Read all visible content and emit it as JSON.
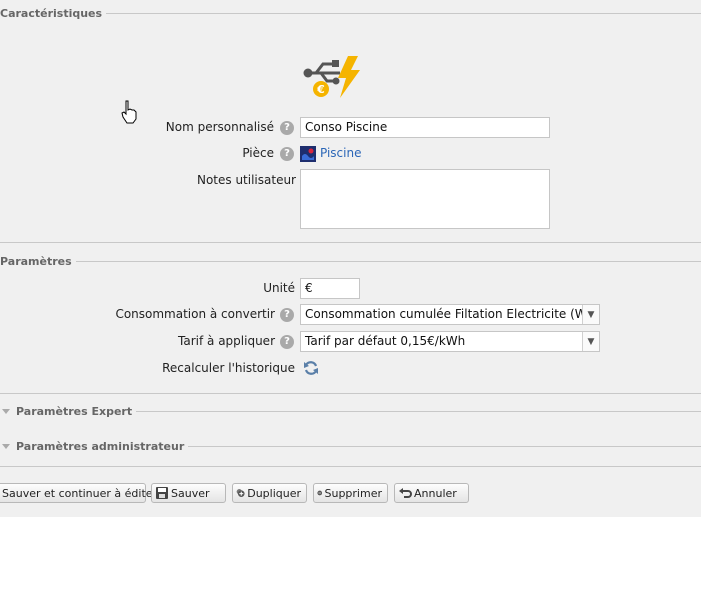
{
  "sections": {
    "characteristics": "Caractéristiques",
    "parameters": "Paramètres",
    "expert": "Paramètres Expert",
    "admin": "Paramètres administrateur"
  },
  "fields": {
    "name_label": "Nom personnalisé",
    "name_value": "Conso Piscine",
    "room_label": "Pièce",
    "room_value": "Piscine",
    "notes_label": "Notes utilisateur",
    "notes_value": "",
    "unit_label": "Unité",
    "unit_value": "€",
    "consumption_label": "Consommation à convertir",
    "consumption_value": "Consommation cumulée Filtation Electricite (Wh)",
    "tariff_label": "Tarif à appliquer",
    "tariff_value": "Tarif par défaut 0,15€/kWh",
    "recalc_label": "Recalculer l'historique"
  },
  "help_glyph": "?",
  "buttons": {
    "save_continue": "Sauver et continuer à éditer",
    "save": "Sauver",
    "duplicate": "Dupliquer",
    "delete": "Supprimer",
    "cancel": "Annuler"
  },
  "icons": {
    "device": "usb-euro-lightning-icon",
    "room": "room-icon",
    "refresh": "refresh-icon",
    "cursor": "hand-cursor-icon"
  },
  "colors": {
    "panel_bg": "#f0f0f0",
    "link": "#2b66b7",
    "lightning": "#f5b400"
  }
}
